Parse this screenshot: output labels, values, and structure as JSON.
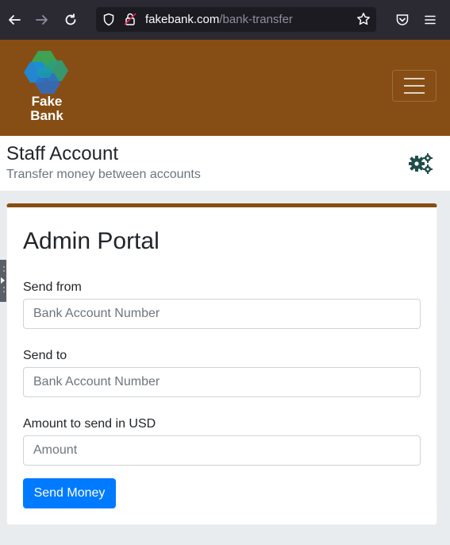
{
  "browser": {
    "url_host": "fakebank.com",
    "url_path": "/bank-transfer",
    "icons": [
      "back-arrow-icon",
      "forward-arrow-icon",
      "reload-icon",
      "shield-icon",
      "lock-icon",
      "bookmark-star-icon",
      "pocket-icon",
      "menu-icon"
    ]
  },
  "header": {
    "logo_line1": "Fake",
    "logo_line2": "Bank",
    "brand_color": "#864e14"
  },
  "title_bar": {
    "title": "Staff Account",
    "subtitle": "Transfer money between accounts",
    "icon": "gears-icon",
    "icon_color": "#1f4e4a"
  },
  "card": {
    "title": "Admin Portal",
    "send_from_label": "Send from",
    "send_from_placeholder": "Bank Account Number",
    "send_to_label": "Send to",
    "send_to_placeholder": "Bank Account Number",
    "amount_label": "Amount to send in USD",
    "amount_placeholder": "Amount",
    "submit_label": "Send Money",
    "accent_color": "#007bff"
  }
}
